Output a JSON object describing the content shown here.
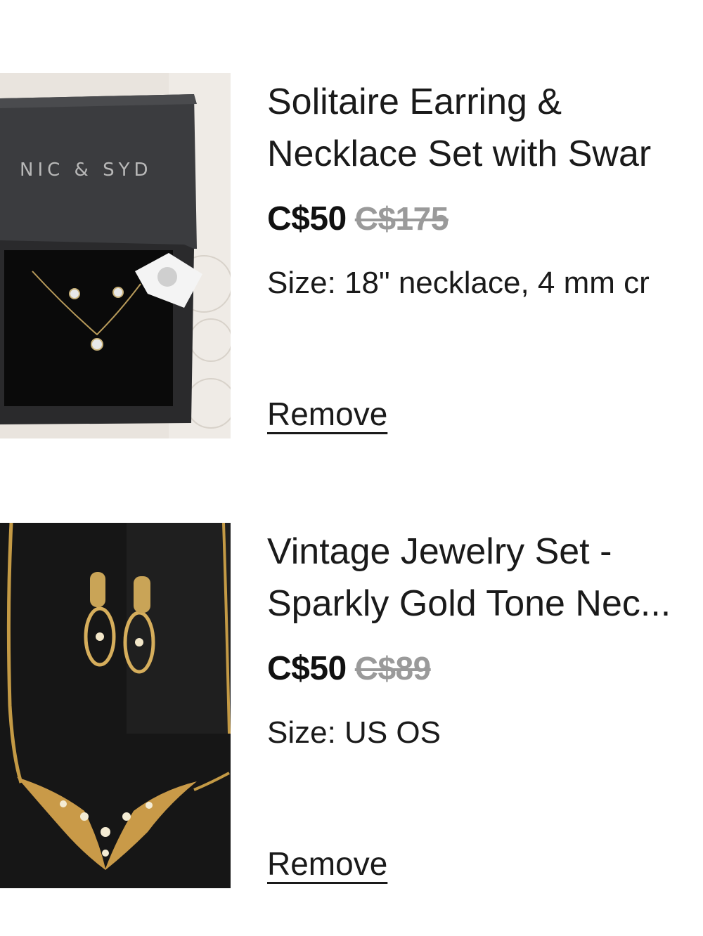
{
  "cart": {
    "items": [
      {
        "title_line1": "Solitaire Earring &",
        "title_line2": "Necklace Set with Swar",
        "price": "C$50",
        "original_price": "C$175",
        "size": "Size: 18\" necklace, 4 mm cr",
        "remove_label": "Remove",
        "image_brand_text": "NIC & SYD"
      },
      {
        "title_line1": "Vintage Jewelry Set -",
        "title_line2": "Sparkly Gold Tone Nec...",
        "price": "C$50",
        "original_price": "C$89",
        "size": "Size: US OS",
        "remove_label": "Remove"
      }
    ]
  },
  "colors": {
    "text": "#1a1a1a",
    "strike_price": "#9a9a9a",
    "background": "#ffffff"
  }
}
